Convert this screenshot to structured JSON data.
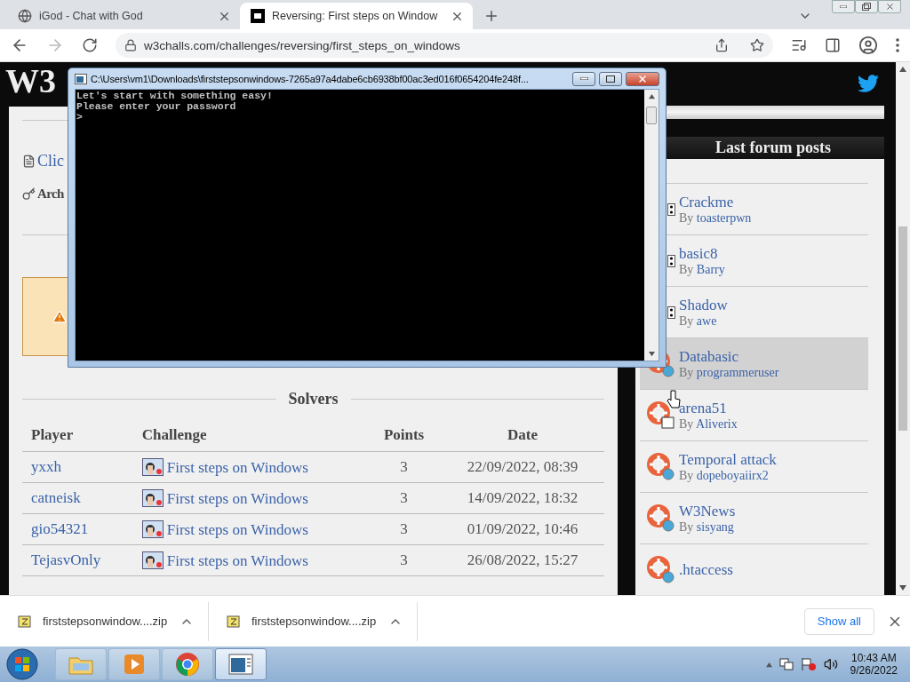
{
  "browser": {
    "tabs": [
      {
        "title": "iGod - Chat with God",
        "selected": false
      },
      {
        "title": "Reversing: First steps on Window",
        "selected": true
      }
    ],
    "nav": [
      {
        "kind": "back",
        "disabled": false
      },
      {
        "kind": "forward",
        "disabled": true
      },
      {
        "kind": "reload",
        "disabled": false
      }
    ],
    "url": "w3challs.com/challenges/reversing/first_steps_on_windows"
  },
  "page": {
    "logo": "W3",
    "links": [
      {
        "kind": "file",
        "label": "Clic"
      },
      {
        "kind": "key",
        "label": "Arch"
      }
    ],
    "solvers": {
      "title": "Solvers",
      "columns": [
        "Player",
        "Challenge",
        "Points",
        "Date"
      ],
      "rows": [
        {
          "player": "yxxh",
          "challenge": "First steps on Windows",
          "points": "3",
          "date": "22/09/2022, 08:39"
        },
        {
          "player": "catneisk",
          "challenge": "First steps on Windows",
          "points": "3",
          "date": "14/09/2022, 18:32"
        },
        {
          "player": "gio54321",
          "challenge": "First steps on Windows",
          "points": "3",
          "date": "01/09/2022, 10:46"
        },
        {
          "player": "TejasvOnly",
          "challenge": "First steps on Windows",
          "points": "3",
          "date": "26/08/2022, 15:27"
        }
      ]
    },
    "forum": {
      "title": "Last forum posts",
      "posts": [
        {
          "kind": "dice-only",
          "title": "Crackme",
          "by": "By",
          "author": "toasterpwn",
          "selected": false
        },
        {
          "kind": "dice-only",
          "title": "basic8",
          "by": "By",
          "author": "Barry",
          "selected": false
        },
        {
          "kind": "dice-only",
          "title": "Shadow",
          "by": "By",
          "author": "awe",
          "selected": false
        },
        {
          "kind": "lifebuoy",
          "title": "Databasic",
          "by": "By",
          "author": "programmeruser",
          "selected": true
        },
        {
          "kind": "lifebuoy",
          "title": "arena51",
          "by": "By",
          "author": "Aliverix",
          "selected": false
        },
        {
          "kind": "lifebuoy",
          "title": "Temporal attack",
          "by": "By",
          "author": "dopeboyaiirx2",
          "selected": false
        },
        {
          "kind": "lifebuoy",
          "title": "W3News",
          "by": "By",
          "author": "sisyang",
          "selected": false
        },
        {
          "kind": "lifebuoy",
          "title": ".htaccess",
          "selected": false
        }
      ]
    }
  },
  "console": {
    "title": "C:\\Users\\vm1\\Downloads\\firststepsonwindows-7265a97a4dabe6cb6938bf00ac3ed016f0654204fe248f...",
    "lines": [
      "Let's start with something easy!",
      "Please enter your password",
      ">"
    ]
  },
  "downloads": {
    "items": [
      {
        "name": "firststepsonwindow....zip"
      },
      {
        "name": "firststepsonwindow....zip"
      }
    ],
    "show_all": "Show all"
  },
  "taskbar": {
    "apps": [
      {
        "kind": "explorer",
        "active": false
      },
      {
        "kind": "media",
        "active": false
      },
      {
        "kind": "chrome",
        "active": false
      },
      {
        "kind": "console",
        "active": true
      }
    ],
    "time": "10:43 AM",
    "date": "9/26/2022"
  }
}
